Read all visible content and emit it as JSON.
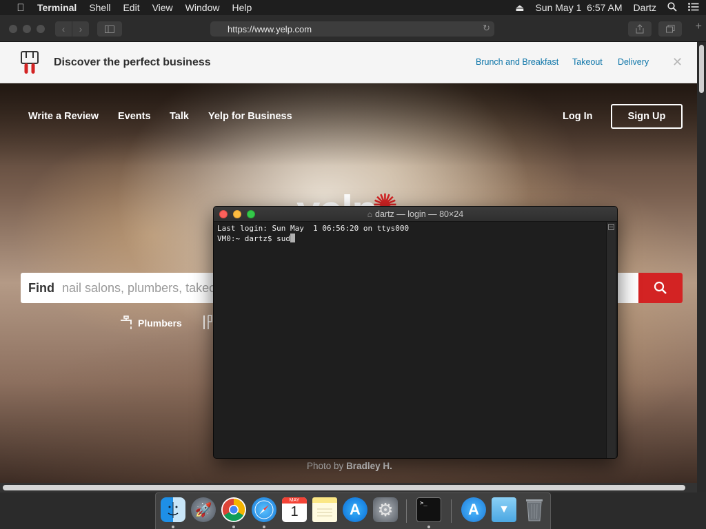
{
  "menubar": {
    "app_name": "Terminal",
    "menus": [
      "Shell",
      "Edit",
      "View",
      "Window",
      "Help"
    ],
    "datetime": "Sun May 1  6:57 AM",
    "user": "Dartz"
  },
  "browser": {
    "url": "https://www.yelp.com"
  },
  "promo": {
    "title": "Discover the perfect business",
    "links": [
      "Brunch and Breakfast",
      "Takeout",
      "Delivery"
    ],
    "close_glyph": "✕"
  },
  "nav": {
    "left_links": [
      "Write a Review",
      "Events",
      "Talk",
      "Yelp for Business"
    ],
    "login": "Log In",
    "signup": "Sign Up"
  },
  "search": {
    "find_label": "Find",
    "placeholder": "nail salons, plumbers, takeo"
  },
  "categories": {
    "plumbers": "Plumbers"
  },
  "photo_credit": {
    "prefix": "Photo by",
    "author": "Bradley H."
  },
  "terminal": {
    "title": "dartz — login — 80×24",
    "line1": "Last login: Sun May  1 06:56:20 on ttys000",
    "prompt": "VM0:~ dartz$ ",
    "input": "sud"
  },
  "dock": {
    "apps": [
      "Finder",
      "Launchpad",
      "Chrome",
      "Safari",
      "Calendar",
      "Notes",
      "App Store",
      "System Preferences",
      "Terminal",
      "Applications",
      "Downloads",
      "Trash"
    ],
    "calendar_month": "MAY",
    "calendar_day": "1"
  },
  "colors": {
    "yelp_red": "#d32323",
    "link_blue": "#0b74a8"
  }
}
